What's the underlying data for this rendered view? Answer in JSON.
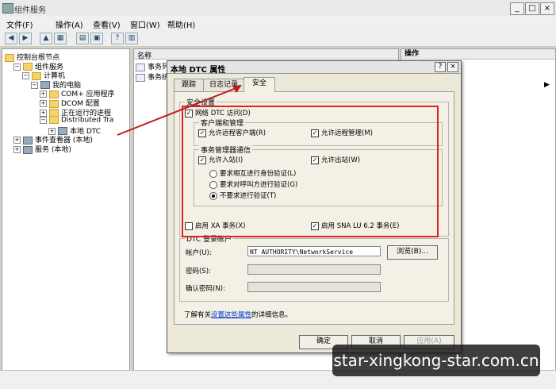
{
  "window": {
    "title": "组件服务",
    "controls": [
      "_",
      "□",
      "×"
    ]
  },
  "menubar": [
    "文件(F)",
    "操作(A)",
    "查看(V)",
    "窗口(W)",
    "帮助(H)"
  ],
  "toolbar_icons": [
    "back-icon",
    "forward-icon",
    "up-icon",
    "show-hide-tree-icon",
    "export-icon",
    "properties-icon",
    "help-icon",
    "view-icon"
  ],
  "tree": [
    {
      "label": "控制台根节点",
      "indent": 0,
      "expander": "",
      "icon": "folder"
    },
    {
      "label": "组件服务",
      "indent": 1,
      "expander": "−",
      "icon": "folder"
    },
    {
      "label": "计算机",
      "indent": 2,
      "expander": "−",
      "icon": "folder"
    },
    {
      "label": "我的电脑",
      "indent": 3,
      "expander": "−",
      "icon": "computer"
    },
    {
      "label": "COM+ 应用程序",
      "indent": 4,
      "expander": "+",
      "icon": "folder"
    },
    {
      "label": "DCOM 配置",
      "indent": 4,
      "expander": "+",
      "icon": "folder"
    },
    {
      "label": "正在运行的进程",
      "indent": 4,
      "expander": "+",
      "icon": "folder"
    },
    {
      "label": "Distributed Tra",
      "indent": 4,
      "expander": "−",
      "icon": "folder"
    },
    {
      "label": "本地 DTC",
      "indent": 5,
      "expander": "+",
      "icon": "computer"
    },
    {
      "label": "事件查看器 (本地)",
      "indent": 1,
      "expander": "+",
      "icon": "computer"
    },
    {
      "label": "服务 (本地)",
      "indent": 1,
      "expander": "+",
      "icon": "computer"
    }
  ],
  "list": {
    "column": "名称",
    "items": [
      "事务列",
      "事务统"
    ]
  },
  "actions": {
    "header": "操作"
  },
  "dialog": {
    "title": "本地 DTC 属性",
    "help_btn": "?",
    "close_btn": "×",
    "tabs": [
      "跟踪",
      "日志记录",
      "安全"
    ],
    "selected_tab": 2,
    "security_group": "安全设置",
    "network_dtc": "网络 DTC 访问(D)",
    "client_group": "客户端和管理",
    "allow_remote_client": "允许远程客户端(R)",
    "allow_remote_admin": "允许远程管理(M)",
    "tm_group": "事务管理器通信",
    "allow_inbound": "允许入站(I)",
    "allow_outbound": "允许出站(W)",
    "radio_mutual": "要求相互进行身份验证(L)",
    "radio_caller": "要求对呼叫方进行验证(G)",
    "radio_none": "不要求进行验证(T)",
    "enable_xa": "启用 XA 事务(X)",
    "enable_sna": "启用 SNA LU 6.2 事务(E)",
    "logon_group": "DTC 登录帐户",
    "account_label": "帐户(U):",
    "account_value": "NT AUTHORITY\\NetworkService",
    "browse_btn": "浏览(B)...",
    "password_label": "密码(S):",
    "confirm_label": "确认密码(N):",
    "info_prefix": "了解有关",
    "info_link": "设置这些属性",
    "info_suffix": "的详细信息。",
    "ok_btn": "确定",
    "cancel_btn": "取消",
    "apply_btn": "应用(A)",
    "checks": {
      "network_dtc": true,
      "allow_remote_client": true,
      "allow_remote_admin": true,
      "allow_inbound": true,
      "allow_outbound": true,
      "enable_xa": false,
      "enable_sna": true
    },
    "selected_radio": "none"
  },
  "watermark": "star-xingkong-star.com.cn",
  "colors": {
    "highlight_box": "#dd2222",
    "arrow": "#c41818"
  }
}
